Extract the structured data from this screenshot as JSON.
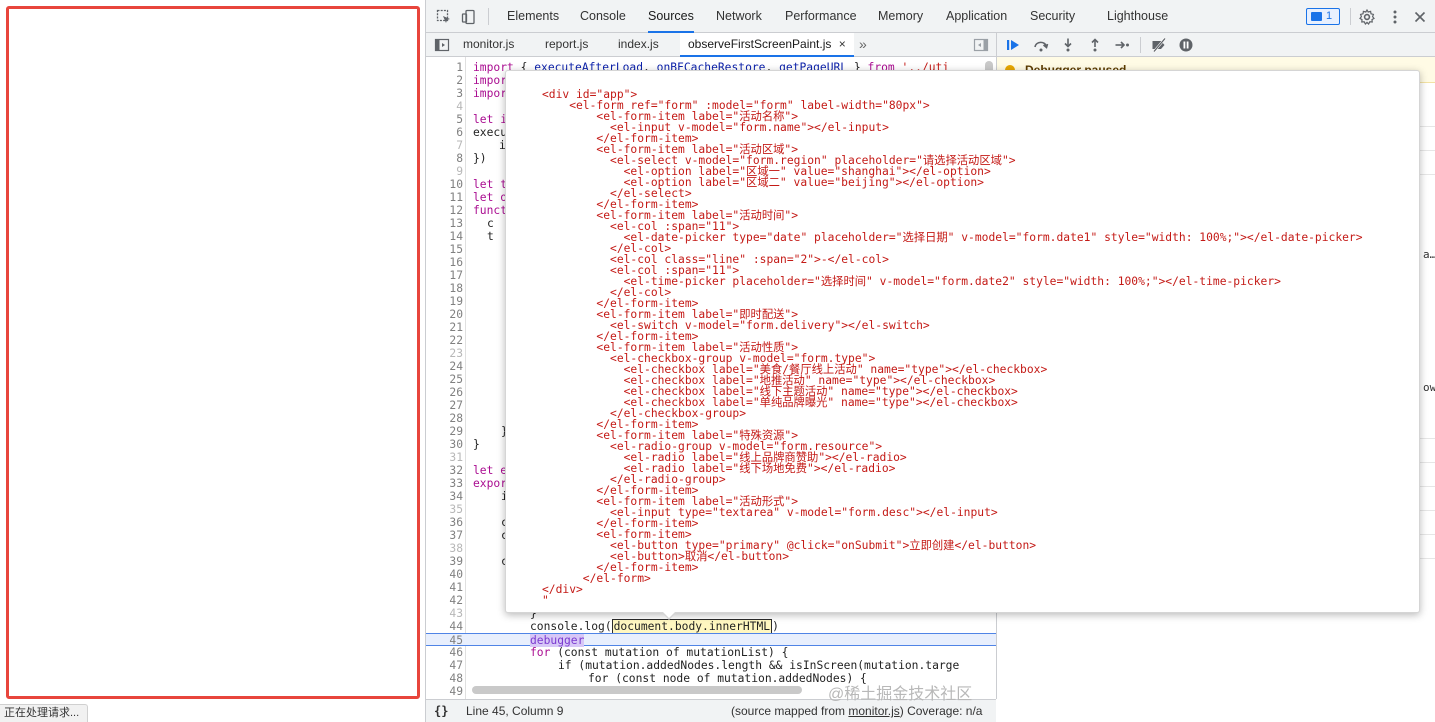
{
  "status_text": "正在处理请求...",
  "toolbar": {
    "tabs": [
      "Elements",
      "Console",
      "Sources",
      "Network",
      "Performance",
      "Memory",
      "Application",
      "Security",
      "Lighthouse"
    ],
    "active_tab": "Sources",
    "issues_count": "1"
  },
  "source_tabs": {
    "files": [
      "monitor.js",
      "report.js",
      "index.js",
      "observeFirstScreenPaint.js"
    ],
    "active_file": "observeFirstScreenPaint.js",
    "close_symbol": "×",
    "more_symbol": "»"
  },
  "sidebar": {
    "paused_text": "Debugger paused",
    "frag_a": "a…",
    "frag_b": "ow"
  },
  "code": {
    "line1_left": "import { executeAfterLoad, onBFCacheRestore, getPageURL } from '../uti",
    "line2": "impor",
    "line3": "impor",
    "line5": "let i",
    "line6": "execu",
    "line7": "i",
    "line8": "})",
    "line10": "let t",
    "line11": "let o",
    "line12": "funct",
    "line13": "c",
    "line14": "t",
    "line29": "}",
    "line30": "}",
    "line32": "let e",
    "line33": "expor",
    "line34": "i",
    "line36": "c",
    "line37": "c",
    "line39": "c",
    "line43": "}",
    "line44_pre": "console.log(",
    "line44_expr": "document.body.innerHTML",
    "line44_post": ")",
    "line45": "debugger",
    "line46_kw1": "for",
    "line46_rest": " (const mutation of mutationList) {",
    "line47": "if (mutation.addedNodes.length && isInScreen(mutation.targe",
    "line48": "for (const node of mutation.addedNodes) {"
  },
  "popover_lines": [
    "<div id=\"app\">",
    "    <el-form ref=\"form\" :model=\"form\" label-width=\"80px\">",
    "        <el-form-item label=\"活动名称\">",
    "          <el-input v-model=\"form.name\"></el-input>",
    "        </el-form-item>",
    "        <el-form-item label=\"活动区域\">",
    "          <el-select v-model=\"form.region\" placeholder=\"请选择活动区域\">",
    "            <el-option label=\"区域一\" value=\"shanghai\"></el-option>",
    "            <el-option label=\"区域二\" value=\"beijing\"></el-option>",
    "          </el-select>",
    "        </el-form-item>",
    "        <el-form-item label=\"活动时间\">",
    "          <el-col :span=\"11\">",
    "            <el-date-picker type=\"date\" placeholder=\"选择日期\" v-model=\"form.date1\" style=\"width: 100%;\"></el-date-picker>",
    "          </el-col>",
    "          <el-col class=\"line\" :span=\"2\">-</el-col>",
    "          <el-col :span=\"11\">",
    "            <el-time-picker placeholder=\"选择时间\" v-model=\"form.date2\" style=\"width: 100%;\"></el-time-picker>",
    "          </el-col>",
    "        </el-form-item>",
    "        <el-form-item label=\"即时配送\">",
    "          <el-switch v-model=\"form.delivery\"></el-switch>",
    "        </el-form-item>",
    "        <el-form-item label=\"活动性质\">",
    "          <el-checkbox-group v-model=\"form.type\">",
    "            <el-checkbox label=\"美食/餐厅线上活动\" name=\"type\"></el-checkbox>",
    "            <el-checkbox label=\"地推活动\" name=\"type\"></el-checkbox>",
    "            <el-checkbox label=\"线下主题活动\" name=\"type\"></el-checkbox>",
    "            <el-checkbox label=\"单纯品牌曝光\" name=\"type\"></el-checkbox>",
    "          </el-checkbox-group>",
    "        </el-form-item>",
    "        <el-form-item label=\"特殊资源\">",
    "          <el-radio-group v-model=\"form.resource\">",
    "            <el-radio label=\"线上品牌商赞助\"></el-radio>",
    "            <el-radio label=\"线下场地免费\"></el-radio>",
    "          </el-radio-group>",
    "        </el-form-item>",
    "        <el-form-item label=\"活动形式\">",
    "          <el-input type=\"textarea\" v-model=\"form.desc\"></el-input>",
    "        </el-form-item>",
    "        <el-form-item>",
    "          <el-button type=\"primary\" @click=\"onSubmit\">立即创建</el-button>",
    "          <el-button>取消</el-button>",
    "        </el-form-item>",
    "      </el-form>",
    "</div>",
    "\""
  ],
  "bottom_bar": {
    "braces": "{}",
    "position": "Line 45, Column 9",
    "source_prefix": "(source mapped from ",
    "source_link": "monitor.js",
    "source_suffix": ")",
    "coverage": "Coverage: n/a"
  },
  "watermark": "@稀土掘金技术社区"
}
